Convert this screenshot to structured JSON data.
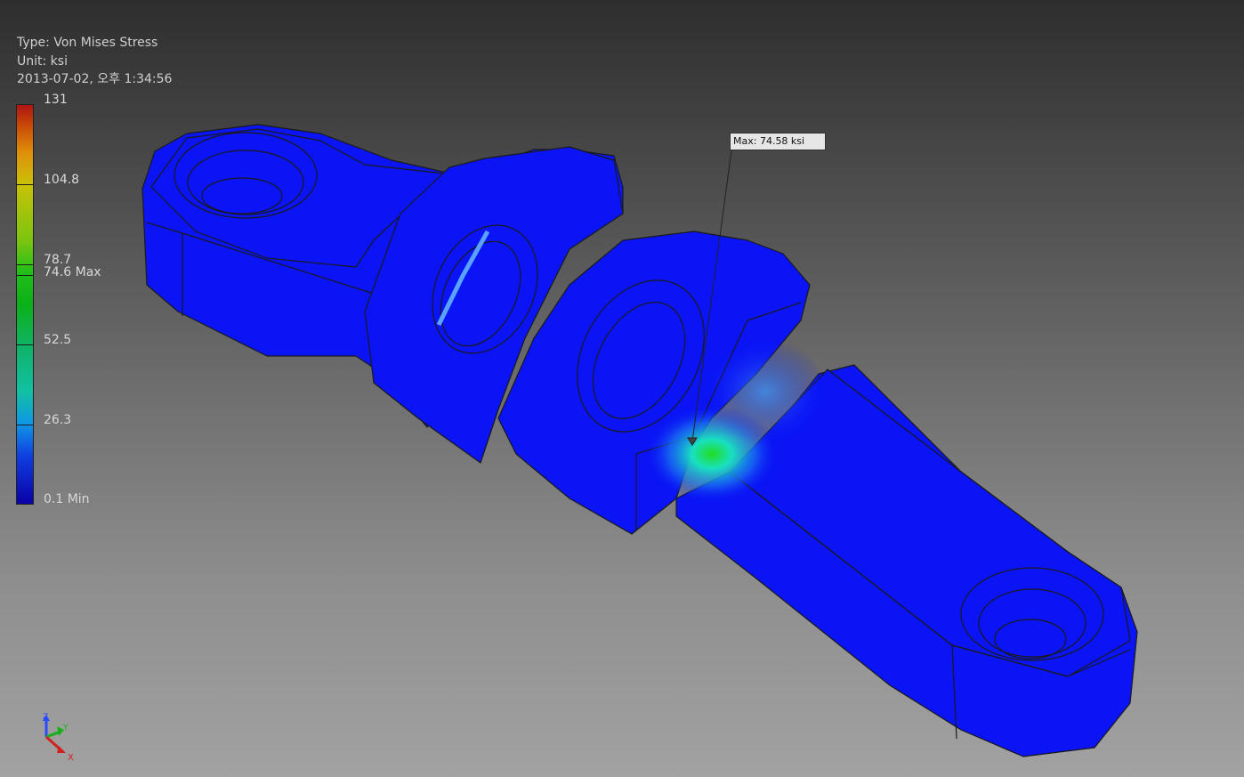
{
  "result": {
    "type_label": "Type: Von Mises Stress",
    "unit_label": "Unit: ksi",
    "timestamp": "2013-07-02, 오후 1:34:56"
  },
  "legend": {
    "ticks": [
      "131",
      "104.8",
      "78.7",
      "74.6 Max",
      "52.5",
      "26.3",
      "0.1 Min"
    ],
    "colors": {
      "max": "#b01414",
      "high": "#c8c208",
      "mid": "#0cb018",
      "low": "#1096e6",
      "min": "#0a00a8"
    }
  },
  "probe": {
    "label": "Max: 74.58 ksi"
  },
  "model": {
    "color": "#0a14f5",
    "edge_color": "#1a1a1a"
  },
  "triad": {
    "axes": [
      "Z",
      "Y",
      "X"
    ]
  }
}
